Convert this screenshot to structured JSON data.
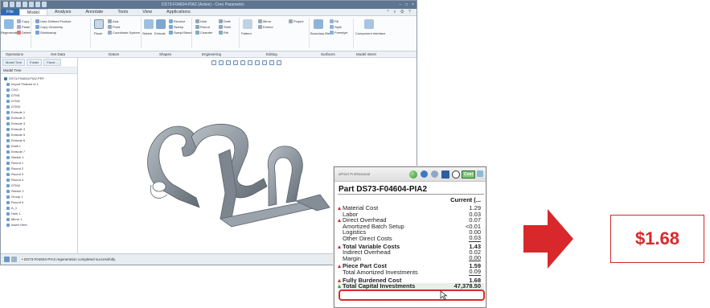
{
  "cad": {
    "window_title": "DS73-F04604-PIA2 (Active) - Creo Parametric",
    "file_tab": "File",
    "tabs": [
      {
        "label": "Model",
        "active": true
      },
      {
        "label": "Analysis",
        "active": false
      },
      {
        "label": "Annotate",
        "active": false
      },
      {
        "label": "Tools",
        "active": false
      },
      {
        "label": "View",
        "active": false
      },
      {
        "label": "Applications",
        "active": false
      }
    ],
    "ribbon_groups": [
      {
        "label": "Operations"
      },
      {
        "label": "Get Data"
      },
      {
        "label": "Datum"
      },
      {
        "label": "Shapes"
      },
      {
        "label": "Engineering"
      },
      {
        "label": "Editing"
      },
      {
        "label": "Surfaces"
      },
      {
        "label": "Model Intent"
      }
    ],
    "ribbon_buttons": {
      "regenerate": "Regenerate",
      "copy": "Copy",
      "paste": "Paste",
      "delete": "Delete",
      "udf": "User-Defined Feature",
      "copy_geometry": "Copy Geometry",
      "shrinkwrap": "Shrinkwrap",
      "plane": "Plane",
      "axis": "Axis",
      "point": "Point",
      "coord_sys": "Coordinate System",
      "sketch": "Sketch",
      "extrude": "Extrude",
      "revolve": "Revolve",
      "sweep": "Sweep",
      "swept_blend": "Swept Blend",
      "hole": "Hole",
      "round": "Round",
      "chamfer": "Chamfer",
      "draft": "Draft",
      "shell": "Shell",
      "rib": "Rib",
      "pattern": "Pattern",
      "mirror": "Mirror",
      "extend": "Extend",
      "project": "Project",
      "boundary_blend": "Boundary Blend",
      "fill": "Fill",
      "style": "Style",
      "freestyle": "Freestyle",
      "component_interface": "Component Interface"
    },
    "subbar": {
      "operations": "Operations",
      "get_data": "Get Data",
      "datum": "Datum",
      "shapes": "Shapes",
      "engineering": "Engineering",
      "editing": "Editing",
      "surfaces": "Surfaces",
      "model_intent": "Model Intent"
    },
    "tree": {
      "tab_model": "Model Tree",
      "tab_folder": "Folder",
      "tab_fav": "Favor...",
      "header": "Model Tree",
      "items": [
        "DS73-F04604-PIA2.PRT",
        "Import Feature id 1",
        "CSO",
        "DTM1",
        "DTM2",
        "DTM3",
        "Extrude 1",
        "Extrude 2",
        "Extrude 3",
        "Extrude 4",
        "Extrude 5",
        "Extrude 6",
        "Draft 1",
        "Extrude 7",
        "Sketch 1",
        "Round 1",
        "Round 2",
        "Round 3",
        "Round 4",
        "DTM4",
        "Sketch 2",
        "Group 1",
        "Round 5",
        "A_1",
        "Hole 1",
        "Mirror 1",
        "Insert Here"
      ]
    },
    "status_message": "• DS73-F04604-PIA2 regeneration completed successfully."
  },
  "costing": {
    "brand": "aPriori Professional",
    "cost_button": "Cost",
    "part_title": "Part DS73-F04604-PIA2",
    "column_header": "Current (...",
    "rows": [
      {
        "label": "Material Cost",
        "value": "1.29",
        "marker": "red",
        "bold": false,
        "underline": false,
        "gap": false
      },
      {
        "label": "Labor",
        "value": "0.03",
        "marker": "",
        "bold": false,
        "underline": false,
        "gap": false
      },
      {
        "label": "Direct Overhead",
        "value": "0.07",
        "marker": "red",
        "bold": false,
        "underline": false,
        "gap": false
      },
      {
        "label": "Amortized Batch Setup",
        "value": "<0.01",
        "marker": "",
        "bold": false,
        "underline": false,
        "gap": false
      },
      {
        "label": "Logistics",
        "value": "0.00",
        "marker": "",
        "bold": false,
        "underline": false,
        "gap": false
      },
      {
        "label": "Other Direct Costs",
        "value": "0.03",
        "marker": "",
        "bold": false,
        "underline": true,
        "gap": false
      },
      {
        "label": "Total Variable Costs",
        "value": "1.43",
        "marker": "red",
        "bold": true,
        "underline": false,
        "gap": true
      },
      {
        "label": "Indirect Overhead",
        "value": "0.02",
        "marker": "",
        "bold": false,
        "underline": false,
        "gap": false
      },
      {
        "label": "Margin",
        "value": "0.00",
        "marker": "",
        "bold": false,
        "underline": true,
        "gap": false
      },
      {
        "label": "Piece Part Cost",
        "value": "1.59",
        "marker": "red",
        "bold": true,
        "underline": false,
        "gap": true
      },
      {
        "label": "Total Amortized Investments",
        "value": "0.09",
        "marker": "",
        "bold": false,
        "underline": true,
        "gap": false
      },
      {
        "label": "Fully Burdened Cost",
        "value": "1.68",
        "marker": "red",
        "bold": true,
        "underline": false,
        "gap": true
      },
      {
        "label": "Total Capital Investments",
        "value": "47,378.50",
        "marker": "green",
        "bold": true,
        "underline": false,
        "gap": false
      }
    ]
  },
  "result": {
    "price": "$1.68"
  },
  "colors": {
    "accent_red": "#d62a2a",
    "arrow_red": "#d8282c",
    "part_gray": "#8d969e"
  }
}
